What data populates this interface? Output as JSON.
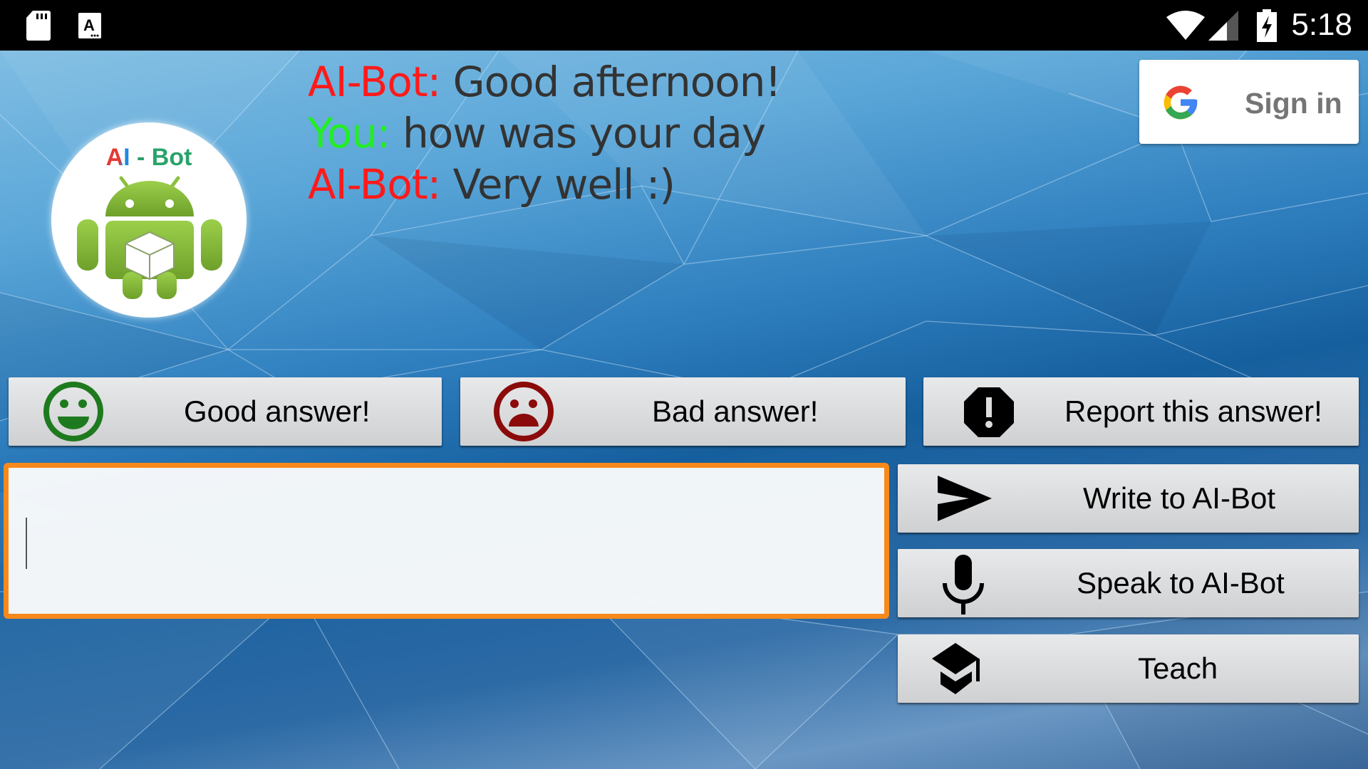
{
  "status_bar": {
    "left_icons": [
      "sd-card-icon",
      "keyboard-a-icon"
    ],
    "right_icons": [
      "wifi-icon",
      "cell-signal-icon",
      "battery-charging-icon"
    ],
    "time": "5:18"
  },
  "sign_in": {
    "icon": "google-g-icon",
    "label": "Sign in"
  },
  "logo": {
    "title_ai": "AI",
    "title_sep": " - ",
    "title_bot": "Bot",
    "icon": "android-robot-icon"
  },
  "chat": {
    "colors": {
      "bot": "#ff1a1a",
      "user": "#22ee22",
      "message": "#333333"
    },
    "messages": [
      {
        "speaker": "AI-Bot:",
        "role": "bot",
        "text": " Good afternoon!"
      },
      {
        "speaker": "You:",
        "role": "user",
        "text": " how was your day"
      },
      {
        "speaker": "AI-Bot:",
        "role": "bot",
        "text": " Very well :)"
      }
    ]
  },
  "feedback": {
    "good": {
      "label": "Good answer!",
      "icon": "smiley-icon",
      "color": "#1e7a1e"
    },
    "bad": {
      "label": "Bad answer!",
      "icon": "sad-face-icon",
      "color": "#8b0a0a"
    },
    "report": {
      "label": "Report this answer!",
      "icon": "report-octagon-icon"
    }
  },
  "input": {
    "value": "",
    "placeholder": ""
  },
  "actions": {
    "write": {
      "label": "Write to AI-Bot",
      "icon": "send-icon"
    },
    "speak": {
      "label": "Speak to AI-Bot",
      "icon": "microphone-icon"
    },
    "teach": {
      "label": "Teach",
      "icon": "graduation-cap-icon"
    }
  },
  "accent_color": "#f7891b"
}
